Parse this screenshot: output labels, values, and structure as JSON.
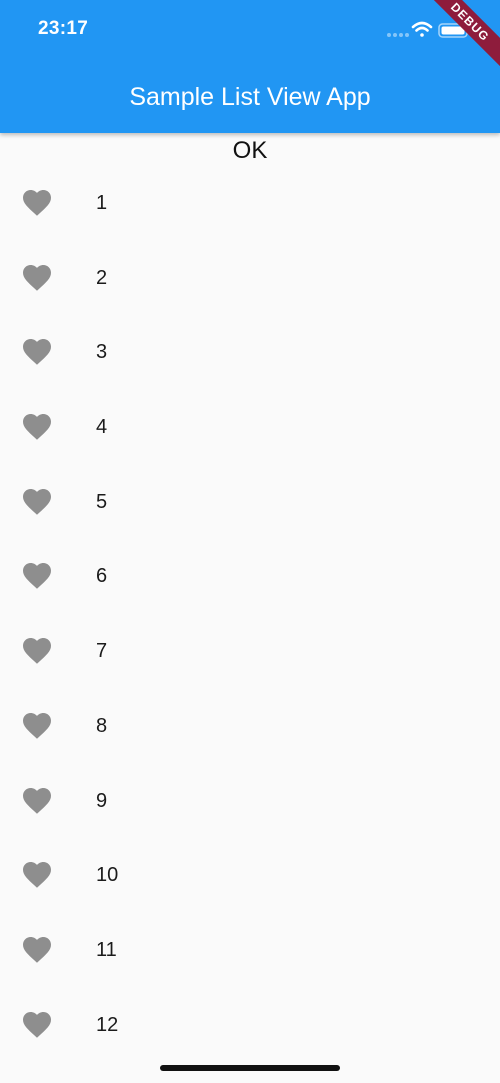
{
  "status_bar": {
    "time": "23:17",
    "debug_label": "DEBUG"
  },
  "app_bar": {
    "title": "Sample List View App",
    "color": "#2196f3"
  },
  "header": {
    "text": "OK"
  },
  "list": {
    "icon": "heart-icon",
    "icon_color": "#8e8e8e",
    "items": [
      {
        "label": "1"
      },
      {
        "label": "2"
      },
      {
        "label": "3"
      },
      {
        "label": "4"
      },
      {
        "label": "5"
      },
      {
        "label": "6"
      },
      {
        "label": "7"
      },
      {
        "label": "8"
      },
      {
        "label": "9"
      },
      {
        "label": "10"
      },
      {
        "label": "11"
      },
      {
        "label": "12"
      }
    ]
  }
}
